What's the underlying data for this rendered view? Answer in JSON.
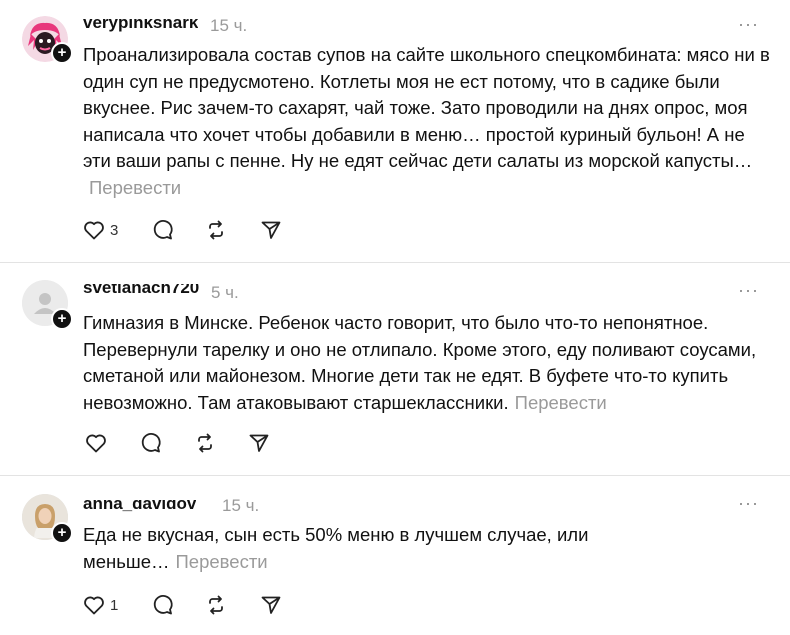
{
  "posts": [
    {
      "username": "verypinkshark",
      "time": "15 ч.",
      "text": "Проанализировала состав супов на сайте школьного спецкомбината: мясо ни в один суп не предусмотено. Котлеты моя не ест потому, что в садике были вкуснее. Рис зачем-то сахарят, чай тоже. Зато проводили на днях опрос, моя написала что хочет чтобы добавили в меню… простой куриный бульон! А не эти ваши рапы с пенне. Ну не едят сейчас дети салаты из морской капусты…",
      "translate": "Перевести",
      "likes": "3",
      "more": "···"
    },
    {
      "username": "svetlanach720",
      "time": "5 ч.",
      "text": "Гимназия в Минске. Ребенок часто говорит, что было что-то непонятное. Перевернули тарелку и оно не отлипало. Кроме этого, еду поливают соусами, сметаной или майонезом. Многие дети так не едят. В буфете что-то купить невозможно. Там атаковывают старшеклассники.",
      "translate": "Перевести",
      "likes": "",
      "more": "···"
    },
    {
      "username": "anna_davidov",
      "time": "15 ч.",
      "text": "Еда не вкусная, сын есть 50% меню в лучшем случае, или меньше…",
      "translate": "Перевести",
      "likes": "1",
      "more": "···"
    }
  ],
  "icons": {
    "like": "heart-icon",
    "reply": "comment-icon",
    "repost": "repost-icon",
    "share": "send-icon",
    "follow": "plus-icon",
    "more": "more-icon"
  },
  "colors": {
    "text": "#111111",
    "muted": "#9a9a9a",
    "divider": "#e3e3e3",
    "avatar1": "#e8377c"
  }
}
